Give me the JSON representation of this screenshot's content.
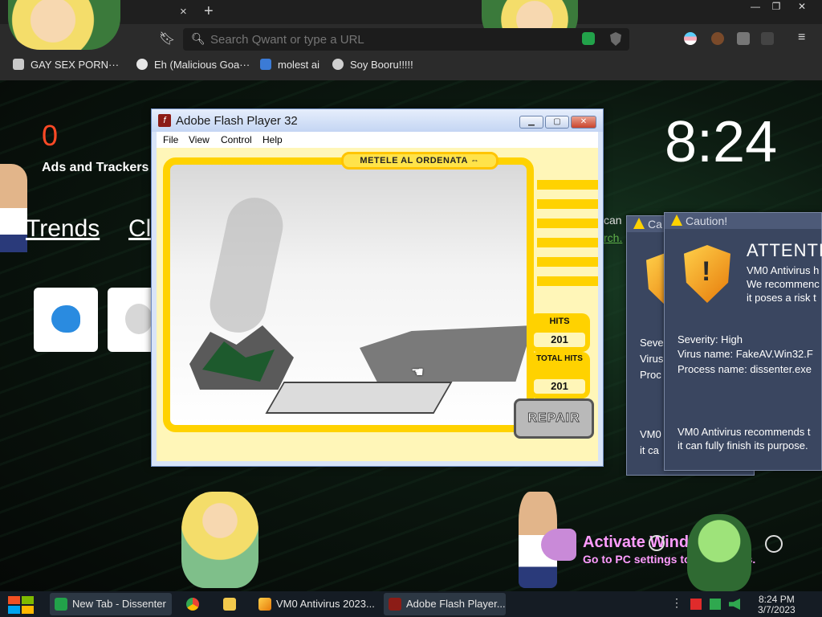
{
  "browser": {
    "url_placeholder": "Search Qwant or type a URL",
    "tab_close": "×",
    "tab_new": "+",
    "window_controls": [
      "—",
      "❐",
      "✕"
    ],
    "menu_icon": "≡",
    "bookmarks": [
      {
        "label": "GAY SEX PORN···",
        "icon": "brave-icon"
      },
      {
        "label": "Eh (Malicious Goa···",
        "icon": "globe-icon"
      },
      {
        "label": "molest ai",
        "icon": "app-icon"
      },
      {
        "label": "Soy Booru!!!!!",
        "icon": "soy-icon"
      }
    ]
  },
  "newtab": {
    "ads_count": "0",
    "ads_label": "Ads and Trackers",
    "trends_label": "Trends",
    "trends_label_2": "Cl",
    "clock": "8:24",
    "side_text": "can",
    "side_link": "rch."
  },
  "flash": {
    "title": "Adobe Flash Player 32",
    "menu": [
      "File",
      "View",
      "Control",
      "Help"
    ],
    "banner": "METELE AL ORDENATA ⇔",
    "hits_label": "HITS",
    "hits_value": "201",
    "total_label": "TOTAL HITS",
    "total_value": "201",
    "repair_label": "REPAIR"
  },
  "caution_back": {
    "title": "Ca",
    "line1": "Seve",
    "line2": "Virus",
    "line3": "Proc",
    "line4": "VM0",
    "line5": "it ca"
  },
  "caution_front": {
    "title": "Caution!",
    "heading": "ATTENTIC",
    "line1": "VM0 Antivirus h",
    "line2": "We recommenc",
    "line3": "it poses a risk t",
    "severity": "Severity: High",
    "virus": "Virus name: FakeAV.Win32.F",
    "process": "Process name: dissenter.exe",
    "rec1": "VM0 Antivirus recommends t",
    "rec2": "it can fully finish its purpose."
  },
  "watermark": {
    "title": "Activate Windo",
    "subtitle": "Go to PC settings to a           Windows."
  },
  "taskbar": {
    "items": [
      {
        "label": "New Tab - Dissenter",
        "active": true
      },
      {
        "label": "",
        "active": false
      },
      {
        "label": "",
        "active": false
      },
      {
        "label": "VM0 Antivirus 2023...",
        "active": false
      },
      {
        "label": "Adobe Flash Player...",
        "active": true
      }
    ],
    "time": "8:24 PM",
    "date": "3/7/2023"
  }
}
